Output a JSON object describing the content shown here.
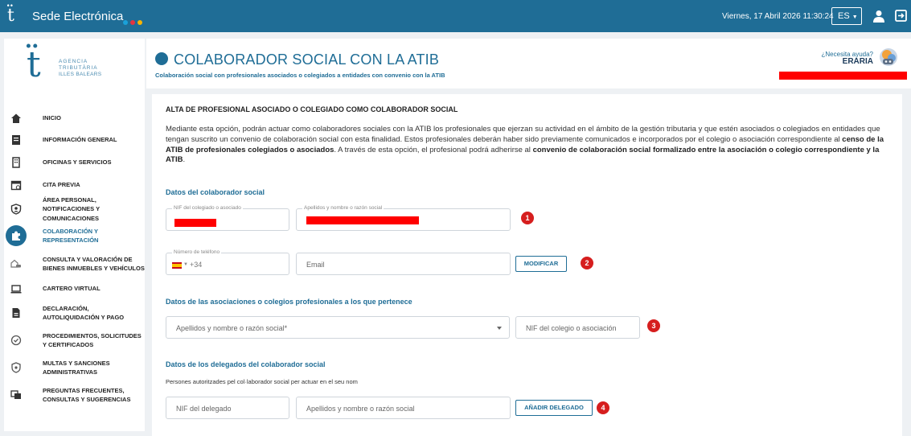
{
  "topbar": {
    "app_name": "Sede Electrónica",
    "dot_colors": [
      "#1aa1d9",
      "#e5343f",
      "#f7b400"
    ],
    "datetime": "Viernes, 17 Abril 2026 11:30:24",
    "language": "ES",
    "icons": [
      "atib-logo-icon",
      "user-icon",
      "logout-icon"
    ]
  },
  "brand": {
    "line1": "AGENCIA",
    "line2": "TRIBUTÀRIA",
    "line3": "ILLES BALEARS"
  },
  "sidebar": {
    "items": [
      {
        "label": "INICIO",
        "icon": "home-icon"
      },
      {
        "label": "INFORMACIÓN GENERAL",
        "icon": "document-icon"
      },
      {
        "label": "OFICINAS Y SERVICIOS",
        "icon": "building-icon"
      },
      {
        "label": "CITA PREVIA",
        "icon": "calendar-icon"
      },
      {
        "label": "ÁREA PERSONAL, NOTIFICACIONES Y COMUNICACIONES",
        "icon": "person-shield-icon"
      },
      {
        "label": "COLABORACIÓN Y REPRESENTACIÓN",
        "icon": "puzzle-icon",
        "active": true
      },
      {
        "label": "CONSULTA Y VALORACIÓN DE BIENES INMUEBLES Y VEHÍCULOS",
        "icon": "house-car-icon"
      },
      {
        "label": "CARTERO VIRTUAL",
        "icon": "laptop-icon"
      },
      {
        "label": "DECLARACIÓN, AUTOLIQUIDACIÓN Y PAGO",
        "icon": "form-icon"
      },
      {
        "label": "PROCEDIMIENTOS, SOLICITUDES Y CERTIFICADOS",
        "icon": "check-circle-icon"
      },
      {
        "label": "MULTAS Y SANCIONES ADMINISTRATIVAS",
        "icon": "shield-icon"
      },
      {
        "label": "PREGUNTAS FRECUENTES, CONSULTAS Y SUGERENCIAS",
        "icon": "chat-icon"
      }
    ]
  },
  "header": {
    "title": "COLABORADOR SOCIAL CON LA ATIB",
    "subtitle": "Colaboración social con profesionales asociados o colegiados a entidades con convenio con la ATIB",
    "help_question": "¿Necesita ayuda?",
    "help_name": "ERARIA"
  },
  "content": {
    "section_title": "ALTA DE PROFESIONAL ASOCIADO O COLEGIADO COMO COLABORADOR SOCIAL",
    "intro": {
      "p1": "Mediante esta opción, podrán actuar como colaboradores sociales con la ATIB los profesionales que ejerzan su actividad en el ámbito de la gestión tributaria y que estén asociados o colegiados en entidades que tengan suscrito un convenio de colaboración social con esta finalidad. Estos profesionales deberán haber sido previamente comunicados e incorporados por el colegio o asociación correspondiente al ",
      "b1": "censo de la ATIB de profesionales colegiados o asociados",
      "p2": ". A través de esta opción, el profesional podrá adherirse al ",
      "b2": "convenio de colaboración social formalizado entre la asociación o colegio correspondiente y la ATIB",
      "p3": "."
    },
    "collaborator": {
      "heading": "Datos del colaborador social",
      "nif_label": "NIF del colegiado o asociado",
      "name_label": "Apellidos y nombre o razón social",
      "phone_label": "Número de teléfono",
      "phone_prefix": "+34",
      "email_placeholder": "Email",
      "modify_button": "MODIFICAR"
    },
    "associations": {
      "heading": "Datos de las asociaciones o colegios profesionales a los que pertenece",
      "select_placeholder": "Apellidos y nombre o razón social*",
      "nif_placeholder": "NIF del colegio o asociación"
    },
    "delegates": {
      "heading": "Datos de los delegados del colaborador social",
      "note": "Persones autoritzades pel col·laborador social per actuar en el seu nom",
      "nif_placeholder": "NIF del delegado",
      "name_placeholder": "Apellidos y nombre o razón social",
      "add_button": "AÑADIR DELEGADO"
    },
    "step_badges": [
      "1",
      "2",
      "3",
      "4"
    ]
  },
  "colors": {
    "primary": "#1f6d96",
    "badge": "#d61e1e",
    "redaction": "#ff0000",
    "background": "#eef1f4"
  }
}
